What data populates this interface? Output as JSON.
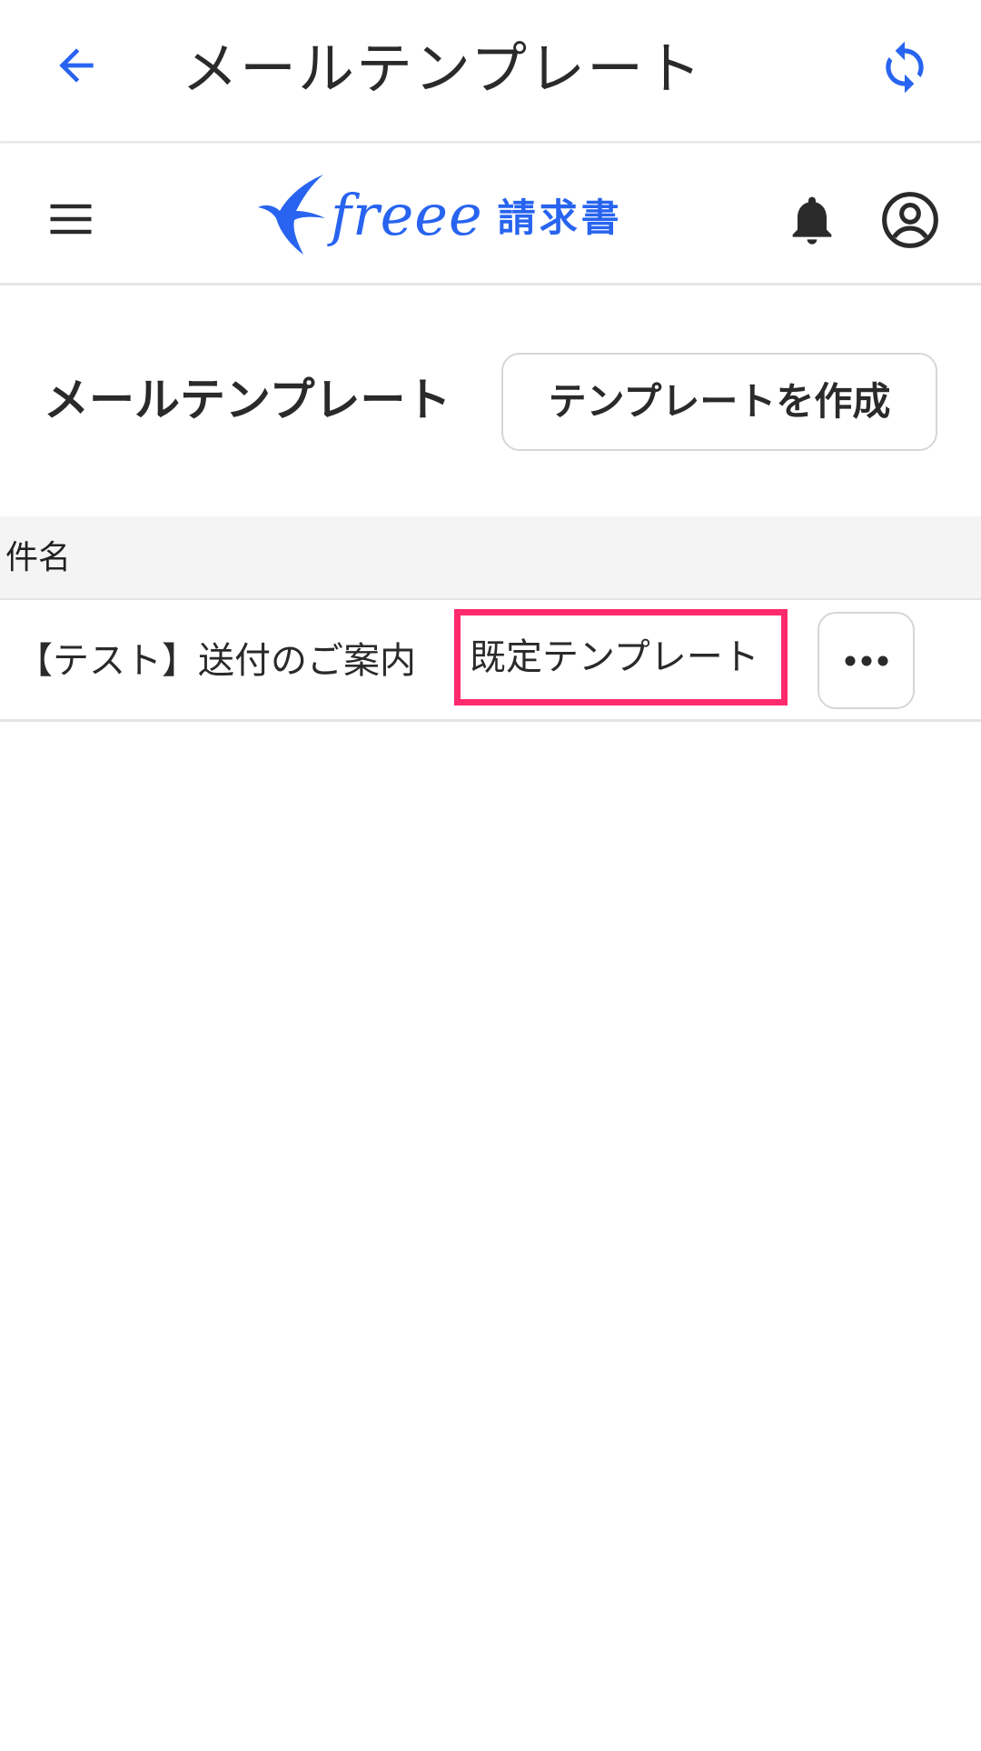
{
  "app_bar": {
    "title": "メールテンプレート",
    "back_icon": "arrow-left-icon",
    "refresh_icon": "refresh-icon",
    "accent_color": "#2864f0"
  },
  "site_header": {
    "menu_icon": "hamburger-menu-icon",
    "logo_wordmark": "freee",
    "logo_product": "請求書",
    "brand_color": "#2864f0",
    "bell_icon": "bell-icon",
    "account_icon": "account-circle-icon"
  },
  "page": {
    "heading": "メールテンプレート",
    "create_button_label": "テンプレートを作成"
  },
  "table": {
    "columns": [
      "件名"
    ],
    "rows": [
      {
        "subject": "【テスト】送付のご案内",
        "badge": "既定テンプレート",
        "more_icon": "more-horizontal-icon"
      }
    ],
    "highlight_color": "#ff2a6d"
  }
}
